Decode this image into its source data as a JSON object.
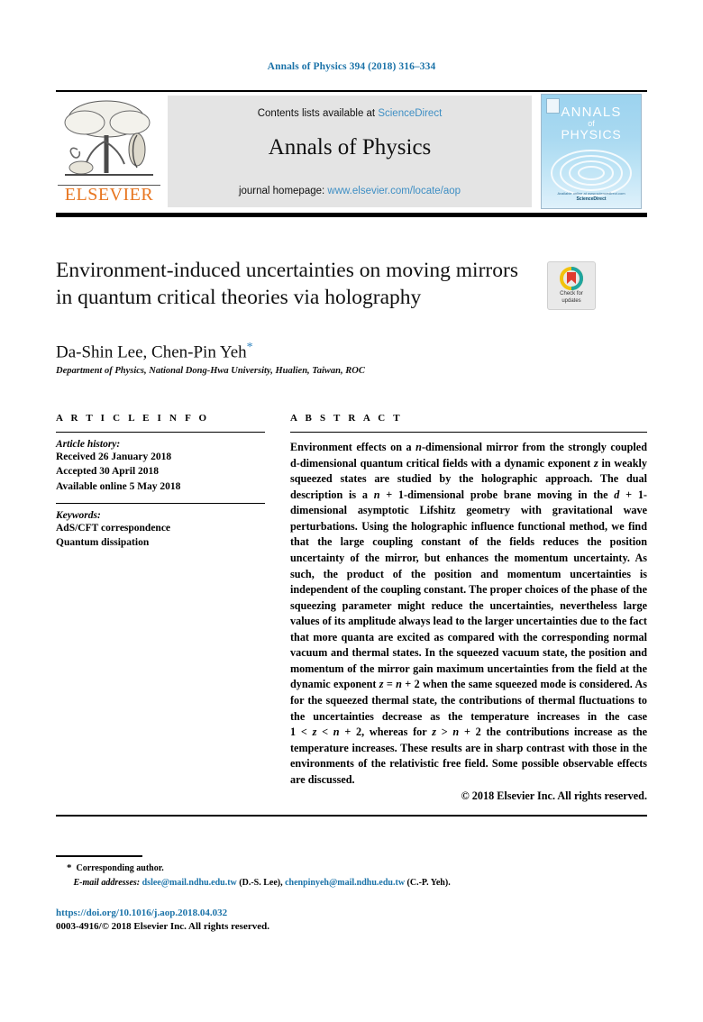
{
  "running_head": "Annals of Physics 394 (2018) 316–334",
  "masthead": {
    "contents_prefix": "Contents lists available at ",
    "sciencedirect_link": "ScienceDirect",
    "journal_name": "Annals of Physics",
    "homepage_prefix": "journal homepage: ",
    "homepage_link": "www.elsevier.com/locate/aop",
    "publisher_wordmark": "ELSEVIER",
    "cover": {
      "line1": "ANNALS",
      "line2": "of",
      "line3": "PHYSICS",
      "foot_small": "Available online at www.sciencedirect.com",
      "foot_brand": "ScienceDirect"
    }
  },
  "article": {
    "title": "Environment-induced uncertainties on moving mirrors in quantum critical theories via holography",
    "authors": "Da-Shin Lee, Chen-Pin Yeh",
    "author_star": "*",
    "affiliation": "Department of Physics, National Dong-Hwa University, Hualien, Taiwan, ROC",
    "crossmark_label_line1": "Check for",
    "crossmark_label_line2": "updates"
  },
  "article_info": {
    "heading": "A R T I C L E   I N F O",
    "history_label": "Article history:",
    "history": [
      "Received 26 January 2018",
      "Accepted 30 April 2018",
      "Available online 5 May 2018"
    ],
    "keywords_label": "Keywords:",
    "keywords": [
      "AdS/CFT correspondence",
      "Quantum dissipation"
    ]
  },
  "abstract": {
    "heading": "A B S T R A C T",
    "copyright": "© 2018 Elsevier Inc. All rights reserved."
  },
  "footer": {
    "corresponding_author": "Corresponding author.",
    "email_label": "E-mail addresses:",
    "email1": "dslee@mail.ndhu.edu.tw",
    "email1_owner": "(D.-S. Lee)",
    "email2": "chenpinyeh@mail.ndhu.edu.tw",
    "email2_owner": "(C.-P. Yeh).",
    "doi": "https://doi.org/10.1016/j.aop.2018.04.032",
    "issn_copyright": "0003-4916/© 2018 Elsevier Inc. All rights reserved."
  },
  "colors": {
    "link_blue": "#1a72a8",
    "sciencedirect_blue": "#3f8fc4",
    "elsevier_orange": "#e87722",
    "masthead_gray": "#e4e4e4",
    "cover_blue": "#a9d9f1"
  }
}
